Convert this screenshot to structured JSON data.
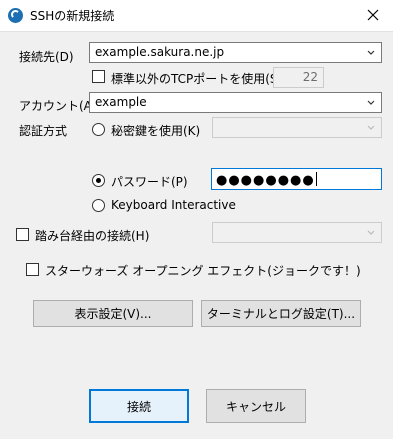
{
  "window": {
    "title": "SSHの新規接続",
    "icon": "teraterm-swirl-icon",
    "accent": "#0078d7"
  },
  "host": {
    "label": "接続先(D)",
    "value": "example.sakura.ne.jp"
  },
  "non_std_port": {
    "label": "標準以外のTCPポートを使用(S)",
    "port": "22"
  },
  "account": {
    "label": "アカウント(A)",
    "value": "example"
  },
  "auth": {
    "label": "認証方式",
    "private_key_label": "秘密鍵を使用(K)",
    "password_label": "パスワード(P)",
    "password_masked": "●●●●●●●●",
    "keyboard_label": "Keyboard Interactive"
  },
  "stepping": {
    "label": "踏み台経由の接続(H)"
  },
  "starwars": {
    "label": "スターウォーズ オープニング エフェクト(ジョークです！)"
  },
  "buttons": {
    "display": "表示設定(V)...",
    "terminal_log": "ターミナルとログ設定(T)...",
    "connect": "接続",
    "cancel": "キャンセル"
  }
}
